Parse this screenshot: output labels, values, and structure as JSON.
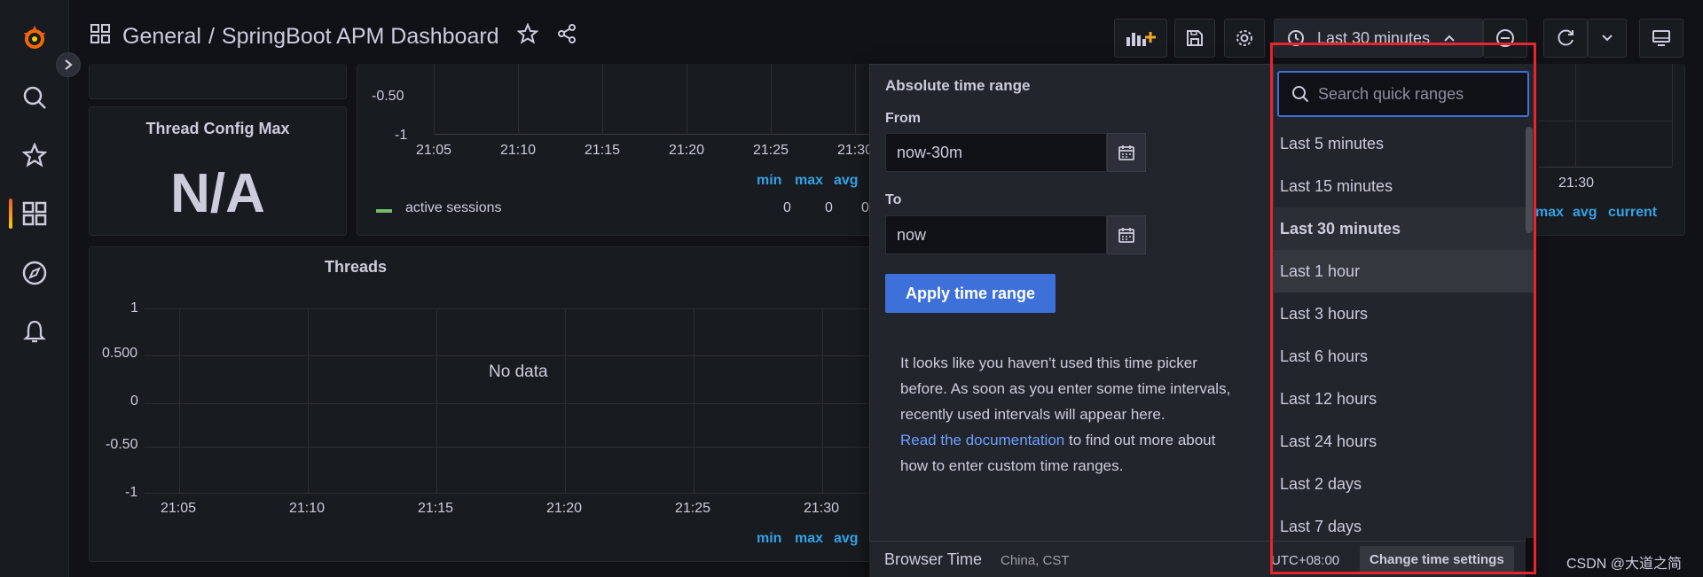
{
  "breadcrumb": {
    "folder": "General",
    "separator": "/",
    "dashboard": "SpringBoot APM Dashboard"
  },
  "toolbar": {
    "time_range": "Last 30 minutes"
  },
  "panels": {
    "thread_config": {
      "title": "Thread Config Max",
      "value": "N/A"
    },
    "sessions": {
      "y_ticks": [
        "-0.50",
        "-1"
      ],
      "x_ticks": [
        "21:05",
        "21:10",
        "21:15",
        "21:20",
        "21:25",
        "21:30"
      ],
      "legend_headers": [
        "min",
        "max",
        "avg"
      ],
      "legend_series": "active sessions",
      "legend_values": [
        "0",
        "0",
        "0"
      ]
    },
    "threads": {
      "title": "Threads",
      "no_data": "No data",
      "y_ticks": [
        "1",
        "0.500",
        "0",
        "-0.50",
        "-1"
      ],
      "x_ticks": [
        "21:05",
        "21:10",
        "21:15",
        "21:20",
        "21:25",
        "21:30"
      ],
      "legend_headers": [
        "min",
        "max",
        "avg"
      ]
    },
    "right": {
      "x_tick": "21:30",
      "legend_headers": [
        "max",
        "avg",
        "current"
      ]
    }
  },
  "picker": {
    "heading": "Absolute time range",
    "from_label": "From",
    "from_value": "now-30m",
    "to_label": "To",
    "to_value": "now",
    "apply_label": "Apply time range",
    "help_text": "It looks like you haven't used this time picker before. As soon as you enter some time intervals, recently used intervals will appear here.",
    "help_link": "Read the documentation",
    "help_tail": " to find out more about how to enter custom time ranges.",
    "search_placeholder": "Search quick ranges",
    "quick_ranges": [
      "Last 5 minutes",
      "Last 15 minutes",
      "Last 30 minutes",
      "Last 1 hour",
      "Last 3 hours",
      "Last 6 hours",
      "Last 12 hours",
      "Last 24 hours",
      "Last 2 days",
      "Last 7 days"
    ],
    "selected_range": "Last 30 minutes",
    "footer_label": "Browser Time",
    "footer_tz": "China, CST",
    "footer_offset": "UTC+08:00",
    "footer_button": "Change time settings"
  },
  "watermark": "CSDN @大道之简",
  "colors": {
    "accent": "#3d71d9",
    "link": "#6e9fff",
    "legend": "#33a2e5",
    "series": "#73bf69",
    "highlight": "#e8242e"
  }
}
